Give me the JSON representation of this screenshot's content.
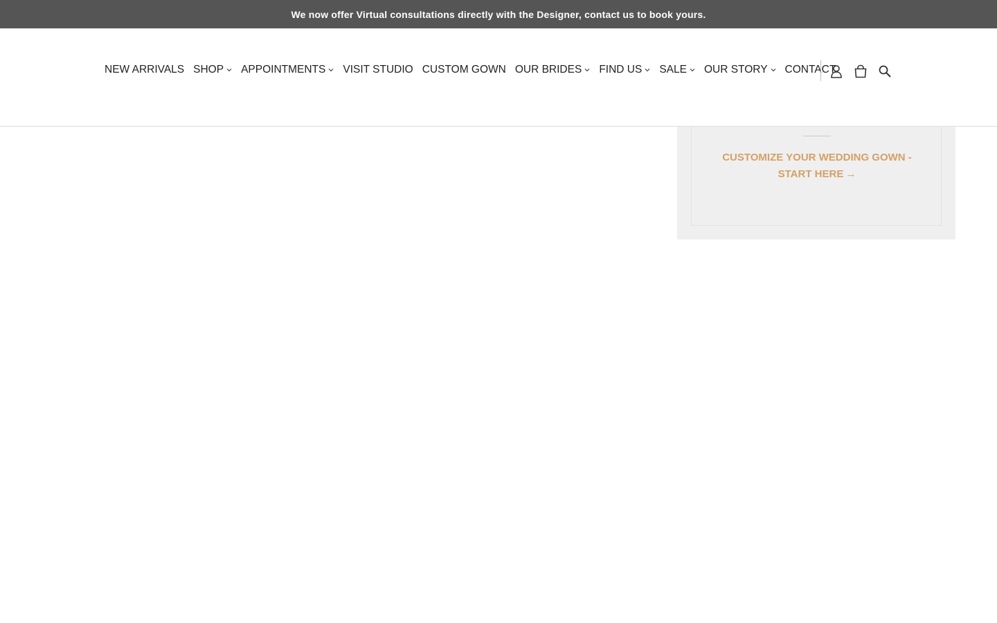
{
  "announcement": {
    "text": "We now offer Virtual consultations directly with the Designer, contact us to book yours."
  },
  "nav": {
    "items": [
      {
        "label": "NEW ARRIVALS",
        "dropdown": false
      },
      {
        "label": "SHOP",
        "dropdown": true
      },
      {
        "label": "APPOINTMENTS",
        "dropdown": true
      },
      {
        "label": "VISIT STUDIO",
        "dropdown": false
      },
      {
        "label": "CUSTOM GOWN",
        "dropdown": false
      },
      {
        "label": "OUR BRIDES",
        "dropdown": true
      },
      {
        "label": "FIND US",
        "dropdown": true
      },
      {
        "label": "SALE",
        "dropdown": true
      },
      {
        "label": "OUR STORY",
        "dropdown": true
      },
      {
        "label": "CONTACT",
        "dropdown": false
      }
    ]
  },
  "header_icons": {
    "account": "user-icon",
    "cart": "cart-icon",
    "search": "search-icon"
  },
  "sidebar": {
    "cta_line1": "CUSTOMIZE YOUR WEDDING GOWN -",
    "cta_line2": "START HERE",
    "cta_arrow": "→"
  },
  "colors": {
    "announcement_bg": "#555555",
    "accent": "#d4a068",
    "sidebar_bg": "#efefef"
  }
}
